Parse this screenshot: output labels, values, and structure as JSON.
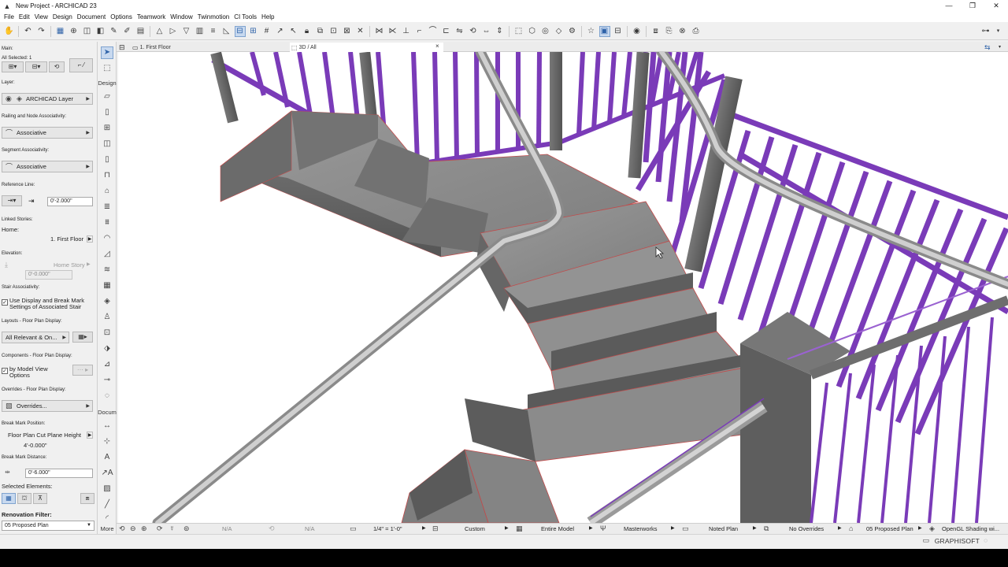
{
  "window": {
    "title": "New Project - ARCHICAD 23",
    "controls": [
      "—",
      "❐",
      "✕"
    ]
  },
  "menu": [
    "File",
    "Edit",
    "View",
    "Design",
    "Document",
    "Options",
    "Teamwork",
    "Window",
    "Twinmotion",
    "CI Tools",
    "Help"
  ],
  "info_box": {
    "main_label": "Main:",
    "selected_label": "All Selected: 1",
    "layer_label": "Layer:",
    "layer_value": "ARCHICAD Layer",
    "railing_assoc_label": "Railing and Node Associativity:",
    "railing_assoc_value": "Associative",
    "segment_assoc_label": "Segment Associativity:",
    "segment_assoc_value": "Associative",
    "reference_line_label": "Reference Line:",
    "reference_line_value": "0'-2.000\"",
    "linked_stories_label": "Linked Stories:",
    "home_label": "Home:",
    "home_value": "1. First Floor",
    "elevation_label": "Elevation:",
    "elevation_story": "Home Story",
    "elevation_value": "0'-0.000\"",
    "stair_assoc_label": "Stair Associativity:",
    "stair_assoc_text_1": "Use Display and Break Mark",
    "stair_assoc_text_2": "Settings of Associated Stair",
    "layouts_label": "Layouts - Floor Plan Display:",
    "layouts_value": "All Relevant & On...",
    "components_label": "Components - Floor Plan Display:",
    "components_text_1": "by Model View",
    "components_text_2": "Options",
    "overrides_label": "Overrides - Floor Plan Display:",
    "overrides_value": "Overrides...",
    "break_mark_pos_label": "Break Mark Position:",
    "break_mark_pos_value": "Floor Plan Cut Plane Height",
    "break_mark_height": "4'-0.000\"",
    "break_mark_dist_label": "Break Mark Distance:",
    "break_mark_dist_value": "0'-6.000\"",
    "selected_elements_label": "Selected Elements:",
    "renovation_label": "Renovation Filter:",
    "renovation_value": "05 Proposed Plan"
  },
  "toolbox": {
    "design_label": "Design",
    "document_label": "Docum",
    "more_label": "More"
  },
  "tabs": {
    "floor_plan": "1. First Floor",
    "view_3d": "3D / All",
    "close_glyph": "×"
  },
  "status": {
    "na_1": "N/A",
    "na_2": "N/A",
    "scale": "1/4\" = 1'-0\"",
    "layer_combo": "Custom",
    "model_view": "Entire Model",
    "pen_set": "Masterworks",
    "dimension": "Noted Plan",
    "overrides": "No Overrides",
    "renovation": "05 Proposed Plan",
    "shading": "OpenGL Shading wi..."
  },
  "brand": "GRAPHISOFT",
  "colors": {
    "railing_purple": "#7a3bb8",
    "railing_purple_light": "#9a62d1",
    "concrete": "#8a8a8a",
    "selection": "#7a3bb8",
    "handrail": "#b4b4b4"
  }
}
